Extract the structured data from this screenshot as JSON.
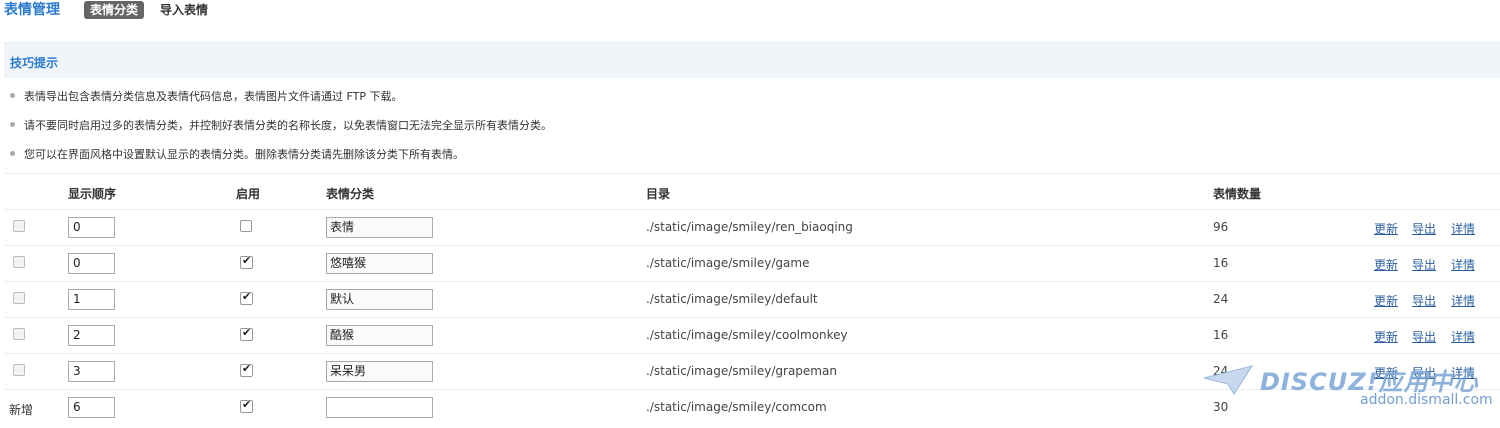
{
  "header": {
    "title": "表情管理",
    "tabs": [
      {
        "label": "表情分类",
        "active": true
      },
      {
        "label": "导入表情",
        "active": false
      }
    ]
  },
  "tips": {
    "title": "技巧提示",
    "items": [
      "表情导出包含表情分类信息及表情代码信息，表情图片文件请通过 FTP 下载。",
      "请不要同时启用过多的表情分类，并控制好表情分类的名称长度，以免表情窗口无法完全显示所有表情分类。",
      "您可以在界面风格中设置默认显示的表情分类。删除表情分类请先删除该分类下所有表情。"
    ]
  },
  "table": {
    "columns": {
      "order": "显示顺序",
      "enabled": "启用",
      "category": "表情分类",
      "directory": "目录",
      "count": "表情数量"
    },
    "rows": [
      {
        "order": "0",
        "enabled": false,
        "name": "表情",
        "dir": "./static/image/smiley/ren_biaoqing",
        "count": "96",
        "actions": [
          "更新",
          "导出",
          "详情"
        ]
      },
      {
        "order": "0",
        "enabled": true,
        "name": "悠嘻猴",
        "dir": "./static/image/smiley/game",
        "count": "16",
        "actions": [
          "更新",
          "导出",
          "详情"
        ]
      },
      {
        "order": "1",
        "enabled": true,
        "name": "默认",
        "dir": "./static/image/smiley/default",
        "count": "24",
        "actions": [
          "更新",
          "导出",
          "详情"
        ]
      },
      {
        "order": "2",
        "enabled": true,
        "name": "酷猴",
        "dir": "./static/image/smiley/coolmonkey",
        "count": "16",
        "actions": [
          "更新",
          "导出",
          "详情"
        ]
      },
      {
        "order": "3",
        "enabled": true,
        "name": "呆呆男",
        "dir": "./static/image/smiley/grapeman",
        "count": "24",
        "actions": [
          "更新",
          "导出",
          "详情"
        ]
      }
    ],
    "new_row": {
      "label": "新增",
      "order": "6",
      "enabled": true,
      "name": "",
      "dir": "./static/image/smiley/comcom",
      "count": "30"
    }
  },
  "watermark": {
    "logo": "DISCUZ!应用中心",
    "url": "addon.dismall.com"
  },
  "colors": {
    "accent": "#2b7acd",
    "tips_bg": "#f1f5fa",
    "link": "#2b5f9e",
    "tab_active_bg": "#666666"
  }
}
